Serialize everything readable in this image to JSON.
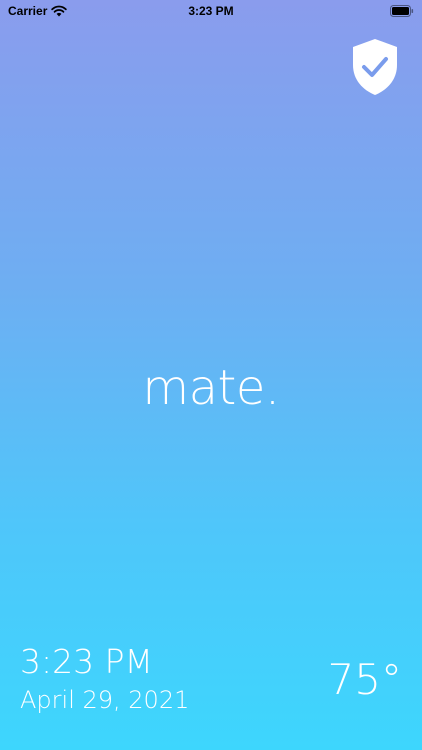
{
  "status_bar": {
    "carrier": "Carrier",
    "time": "3:23 PM",
    "icons": [
      "wifi-icon",
      "battery-icon"
    ]
  },
  "header": {
    "shield_icon": "shield-check-icon"
  },
  "main": {
    "logo": "mate."
  },
  "footer": {
    "time": "3:23 PM",
    "date": "April 29, 2021",
    "temperature": "75°"
  },
  "colors": {
    "gradient_top": "#8a9ced",
    "gradient_bottom": "#3dd6fd",
    "shield_check": "#7a9cec",
    "text": "#ffffff"
  }
}
